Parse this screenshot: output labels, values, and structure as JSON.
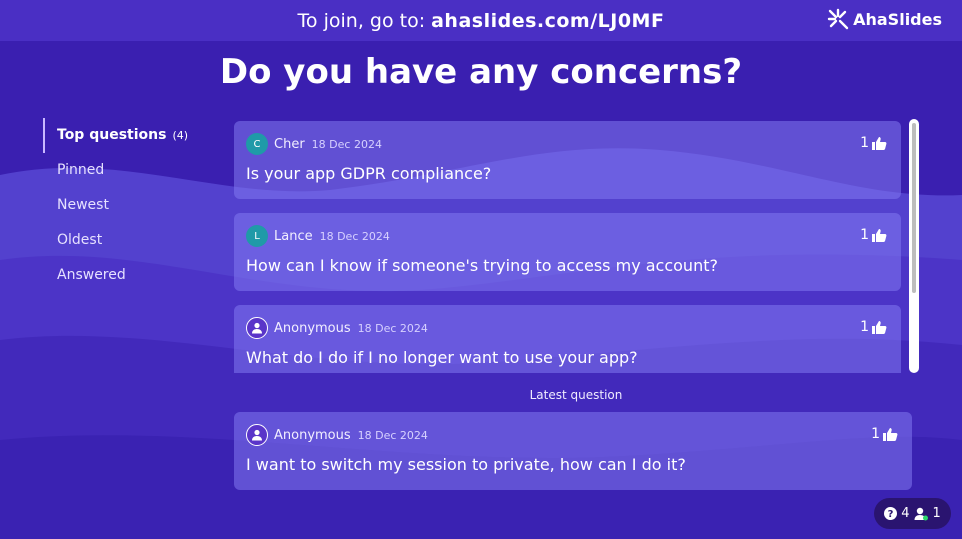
{
  "header": {
    "join_prefix": "To join, go to:",
    "join_url": "ahaslides.com/LJ0MF",
    "logo_text": "AhaSlides"
  },
  "title": "Do you have any concerns?",
  "sidebar": {
    "items": [
      {
        "label": "Top questions",
        "count": "(4)"
      },
      {
        "label": "Pinned"
      },
      {
        "label": "Newest"
      },
      {
        "label": "Oldest"
      },
      {
        "label": "Answered"
      }
    ]
  },
  "questions": [
    {
      "avatar": "C",
      "author": "Cher",
      "date": "18 Dec 2024",
      "votes": "1",
      "text": "Is your app GDPR compliance?"
    },
    {
      "avatar": "L",
      "author": "Lance",
      "date": "18 Dec 2024",
      "votes": "1",
      "text": "How can I know if someone's trying to access my account?"
    },
    {
      "avatar": "user-icon",
      "author": "Anonymous",
      "date": "18 Dec 2024",
      "votes": "1",
      "text": "What do I do if I no longer want to use your app?"
    }
  ],
  "latest": {
    "label": "Latest question",
    "avatar": "user-icon",
    "author": "Anonymous",
    "date": "18 Dec 2024",
    "votes": "1",
    "text": "I want to switch my session to private, how can I do it?"
  },
  "stats": {
    "questions_count": "4",
    "participants_count": "1"
  },
  "colors": {
    "background": "#3a1fb0",
    "card": "#8278f0",
    "teal_avatar": "#1f9aa8"
  }
}
